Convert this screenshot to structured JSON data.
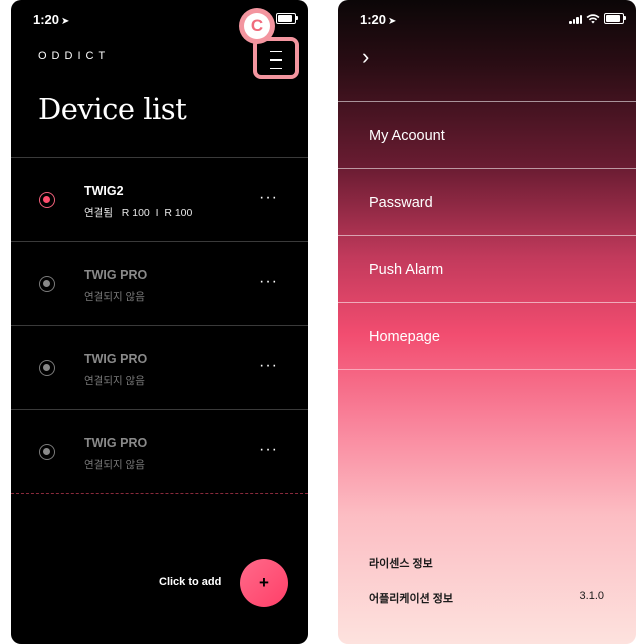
{
  "left_screen": {
    "status": {
      "time": "1:20"
    },
    "logo": "ODDICT",
    "title": "Device list",
    "callout": "C",
    "devices": [
      {
        "name": "TWIG2",
        "status": "연결됨   R 100  I  R 100",
        "active": true
      },
      {
        "name": "TWIG PRO",
        "status": "연결되지 않음",
        "active": false
      },
      {
        "name": "TWIG PRO",
        "status": "연결되지 않음",
        "active": false
      },
      {
        "name": "TWIG PRO",
        "status": "연결되지 않음",
        "active": false
      }
    ],
    "more_glyph": "···",
    "add_label": "Click to add",
    "add_glyph": "+"
  },
  "right_screen": {
    "status": {
      "time": "1:20"
    },
    "back_glyph": "›",
    "menu": [
      {
        "label": "My Acoount"
      },
      {
        "label": "Passward"
      },
      {
        "label": "Push Alarm"
      },
      {
        "label": "Homepage"
      }
    ],
    "license_label": "라이센스 정보",
    "app_info_label": "어플리케이션 정보",
    "version": "3.1.0"
  },
  "colors": {
    "accent": "#ff4d6d",
    "callout": "#f3959f",
    "left_bg": "#000000"
  },
  "icons": [
    "location-arrow-icon",
    "signal-icon",
    "wifi-icon",
    "battery-icon",
    "hamburger-menu-icon",
    "radio-icon",
    "more-icon",
    "plus-icon",
    "chevron-right-icon"
  ]
}
